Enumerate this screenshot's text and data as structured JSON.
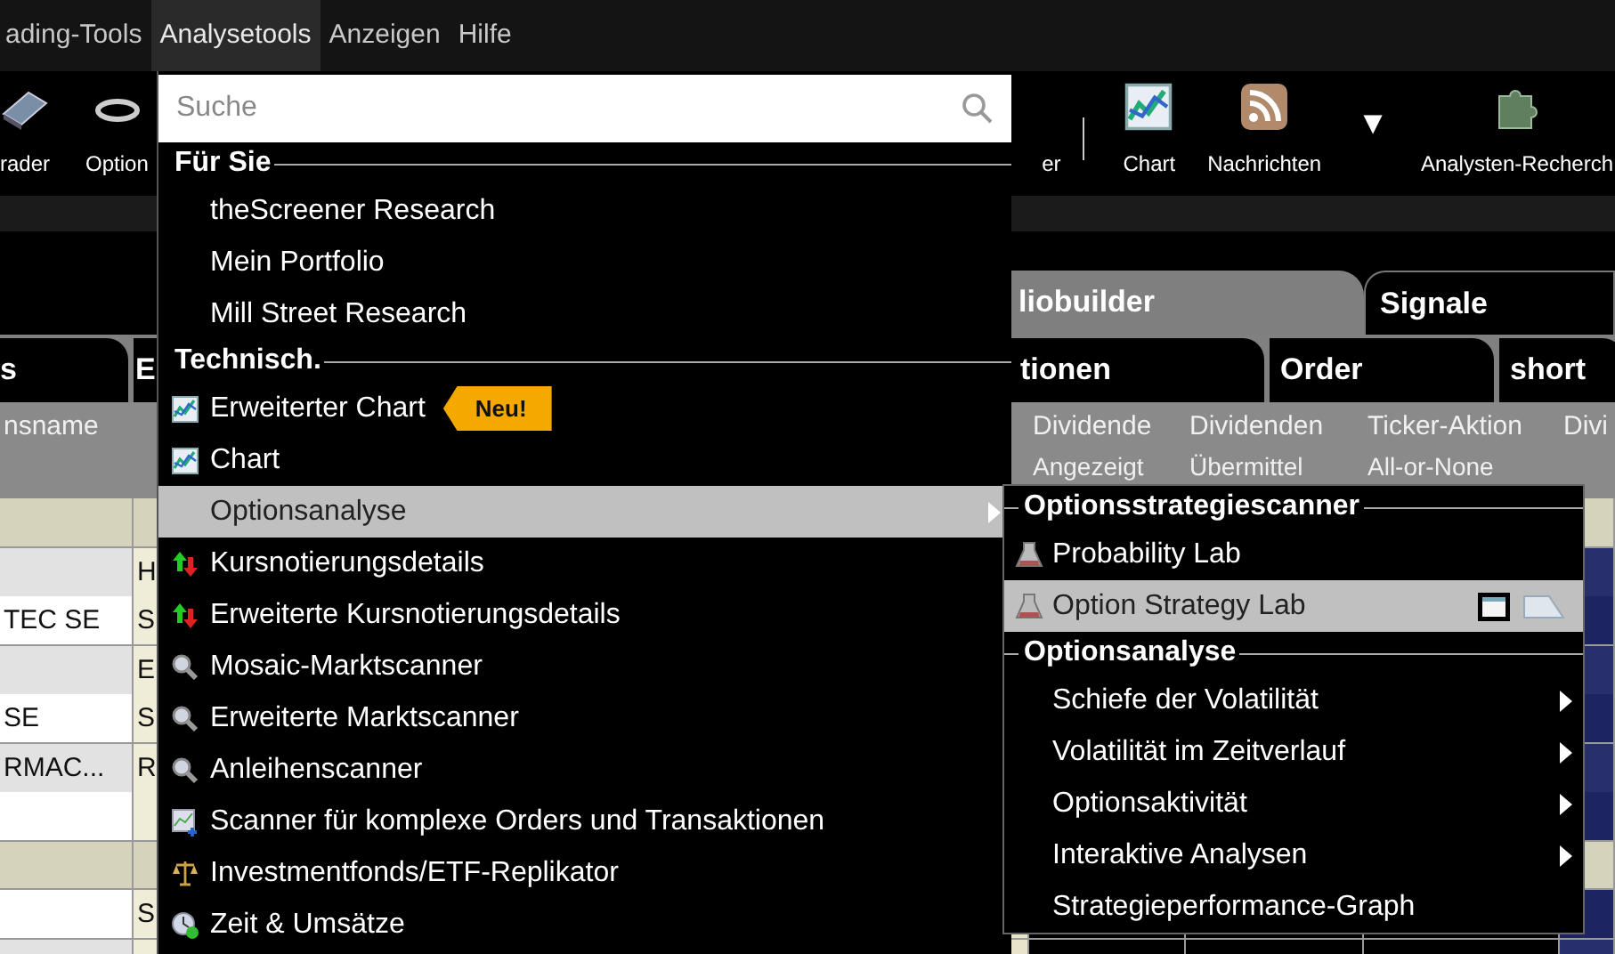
{
  "menubar": [
    {
      "label": "ading-Tools",
      "selected": false
    },
    {
      "label": "Analysetools",
      "selected": true
    },
    {
      "label": "Anzeigen",
      "selected": false
    },
    {
      "label": "Hilfe",
      "selected": false
    }
  ],
  "toolbar": [
    {
      "kind": "book",
      "label": "rader"
    },
    {
      "kind": "link",
      "label": "Option"
    },
    {
      "kind": "text",
      "label": "er"
    },
    {
      "kind": "separator"
    },
    {
      "kind": "chart",
      "label": "Chart"
    },
    {
      "kind": "rss",
      "label": "Nachrichten"
    },
    {
      "kind": "dropdown",
      "label": "▼"
    },
    {
      "kind": "puzzle",
      "label": "Analysten-Recherch"
    }
  ],
  "tabs": [
    {
      "label": "liobuilder",
      "selected": true
    },
    {
      "label": "Signale",
      "selected": false
    }
  ],
  "subtabs": [
    {
      "label": "s"
    },
    {
      "label": "E"
    },
    {
      "label": "tionen"
    },
    {
      "label": "Order"
    },
    {
      "label": "short"
    }
  ],
  "table": {
    "header_row_1": [
      "nsname",
      "Dividende",
      "Dividenden",
      "Ticker-Aktion",
      "Divi"
    ],
    "header_row_2": [
      "Angezeigt",
      "Übermittel",
      "All-or-None"
    ],
    "rows": [
      {
        "kind": "group",
        "cells": []
      },
      {
        "kind": "shaded",
        "cells": [
          "",
          "H"
        ]
      },
      {
        "kind": "plain",
        "cells": [
          "TEC SE",
          "S"
        ]
      },
      {
        "kind": "shaded",
        "cells": [
          "",
          "E"
        ]
      },
      {
        "kind": "plain",
        "cells": [
          "SE",
          "S"
        ]
      },
      {
        "kind": "shaded",
        "cells": [
          "RMAC...",
          "R"
        ]
      },
      {
        "kind": "plain",
        "cells": []
      },
      {
        "kind": "group",
        "cells": []
      },
      {
        "kind": "plain",
        "cells": [
          "",
          "S"
        ]
      },
      {
        "kind": "shaded",
        "cells": []
      }
    ]
  },
  "menu": {
    "search": {
      "placeholder": "Suche"
    },
    "sections": [
      {
        "title": "Für Sie",
        "items": [
          {
            "kind": "plain",
            "label": "theScreener Research",
            "selected": false,
            "has_submenu": false
          },
          {
            "kind": "plain",
            "label": "Mein Portfolio",
            "selected": false,
            "has_submenu": false
          },
          {
            "kind": "plain",
            "label": "Mill Street Research",
            "selected": false,
            "has_submenu": false
          }
        ]
      },
      {
        "title": "Technisch.",
        "items": [
          {
            "kind": "chart",
            "label": "Erweiterter Chart",
            "badge": "Neu!",
            "selected": false,
            "has_submenu": false
          },
          {
            "kind": "chart",
            "label": "Chart",
            "selected": false,
            "has_submenu": false
          },
          {
            "kind": "plain",
            "label": "Optionsanalyse",
            "selected": true,
            "has_submenu": true
          },
          {
            "kind": "quote",
            "label": "Kursnotierungsdetails",
            "selected": false,
            "has_submenu": false
          },
          {
            "kind": "quote",
            "label": "Erweiterte Kursnotierungsdetails",
            "selected": false,
            "has_submenu": false
          },
          {
            "kind": "scanner",
            "label": "Mosaic-Marktscanner",
            "selected": false,
            "has_submenu": false
          },
          {
            "kind": "scanner",
            "label": "Erweiterte Marktscanner",
            "selected": false,
            "has_submenu": false
          },
          {
            "kind": "scanner",
            "label": "Anleihenscanner",
            "selected": false,
            "has_submenu": false
          },
          {
            "kind": "combo",
            "label": "Scanner für komplexe Orders und Transaktionen",
            "selected": false,
            "has_submenu": false
          },
          {
            "kind": "fund",
            "label": "Investmentfonds/ETF-Replikator",
            "selected": false,
            "has_submenu": false
          },
          {
            "kind": "trades",
            "label": "Zeit & Umsätze",
            "selected": false,
            "has_submenu": false
          }
        ]
      }
    ]
  },
  "submenu": {
    "sections": [
      {
        "title": "Optionsstrategiescanner",
        "items": [
          {
            "kind": "lab",
            "label": "Probability Lab",
            "selected": false,
            "has_submenu": false,
            "window_buttons": false
          },
          {
            "kind": "lab",
            "label": "Option Strategy Lab",
            "selected": true,
            "has_submenu": false,
            "window_buttons": true
          }
        ]
      },
      {
        "title": "Optionsanalyse",
        "items": [
          {
            "kind": "plain",
            "label": "Schiefe der Volatilität",
            "selected": false,
            "has_submenu": true,
            "window_buttons": false
          },
          {
            "kind": "plain",
            "label": "Volatilität im Zeitverlauf",
            "selected": false,
            "has_submenu": true,
            "window_buttons": false
          },
          {
            "kind": "plain",
            "label": "Optionsaktivität",
            "selected": false,
            "has_submenu": true,
            "window_buttons": false
          },
          {
            "kind": "plain",
            "label": "Interaktive Analysen",
            "selected": false,
            "has_submenu": true,
            "window_buttons": false
          },
          {
            "kind": "plain",
            "label": "Strategieperformance-Graph",
            "selected": false,
            "has_submenu": false,
            "window_buttons": false
          }
        ]
      }
    ]
  }
}
